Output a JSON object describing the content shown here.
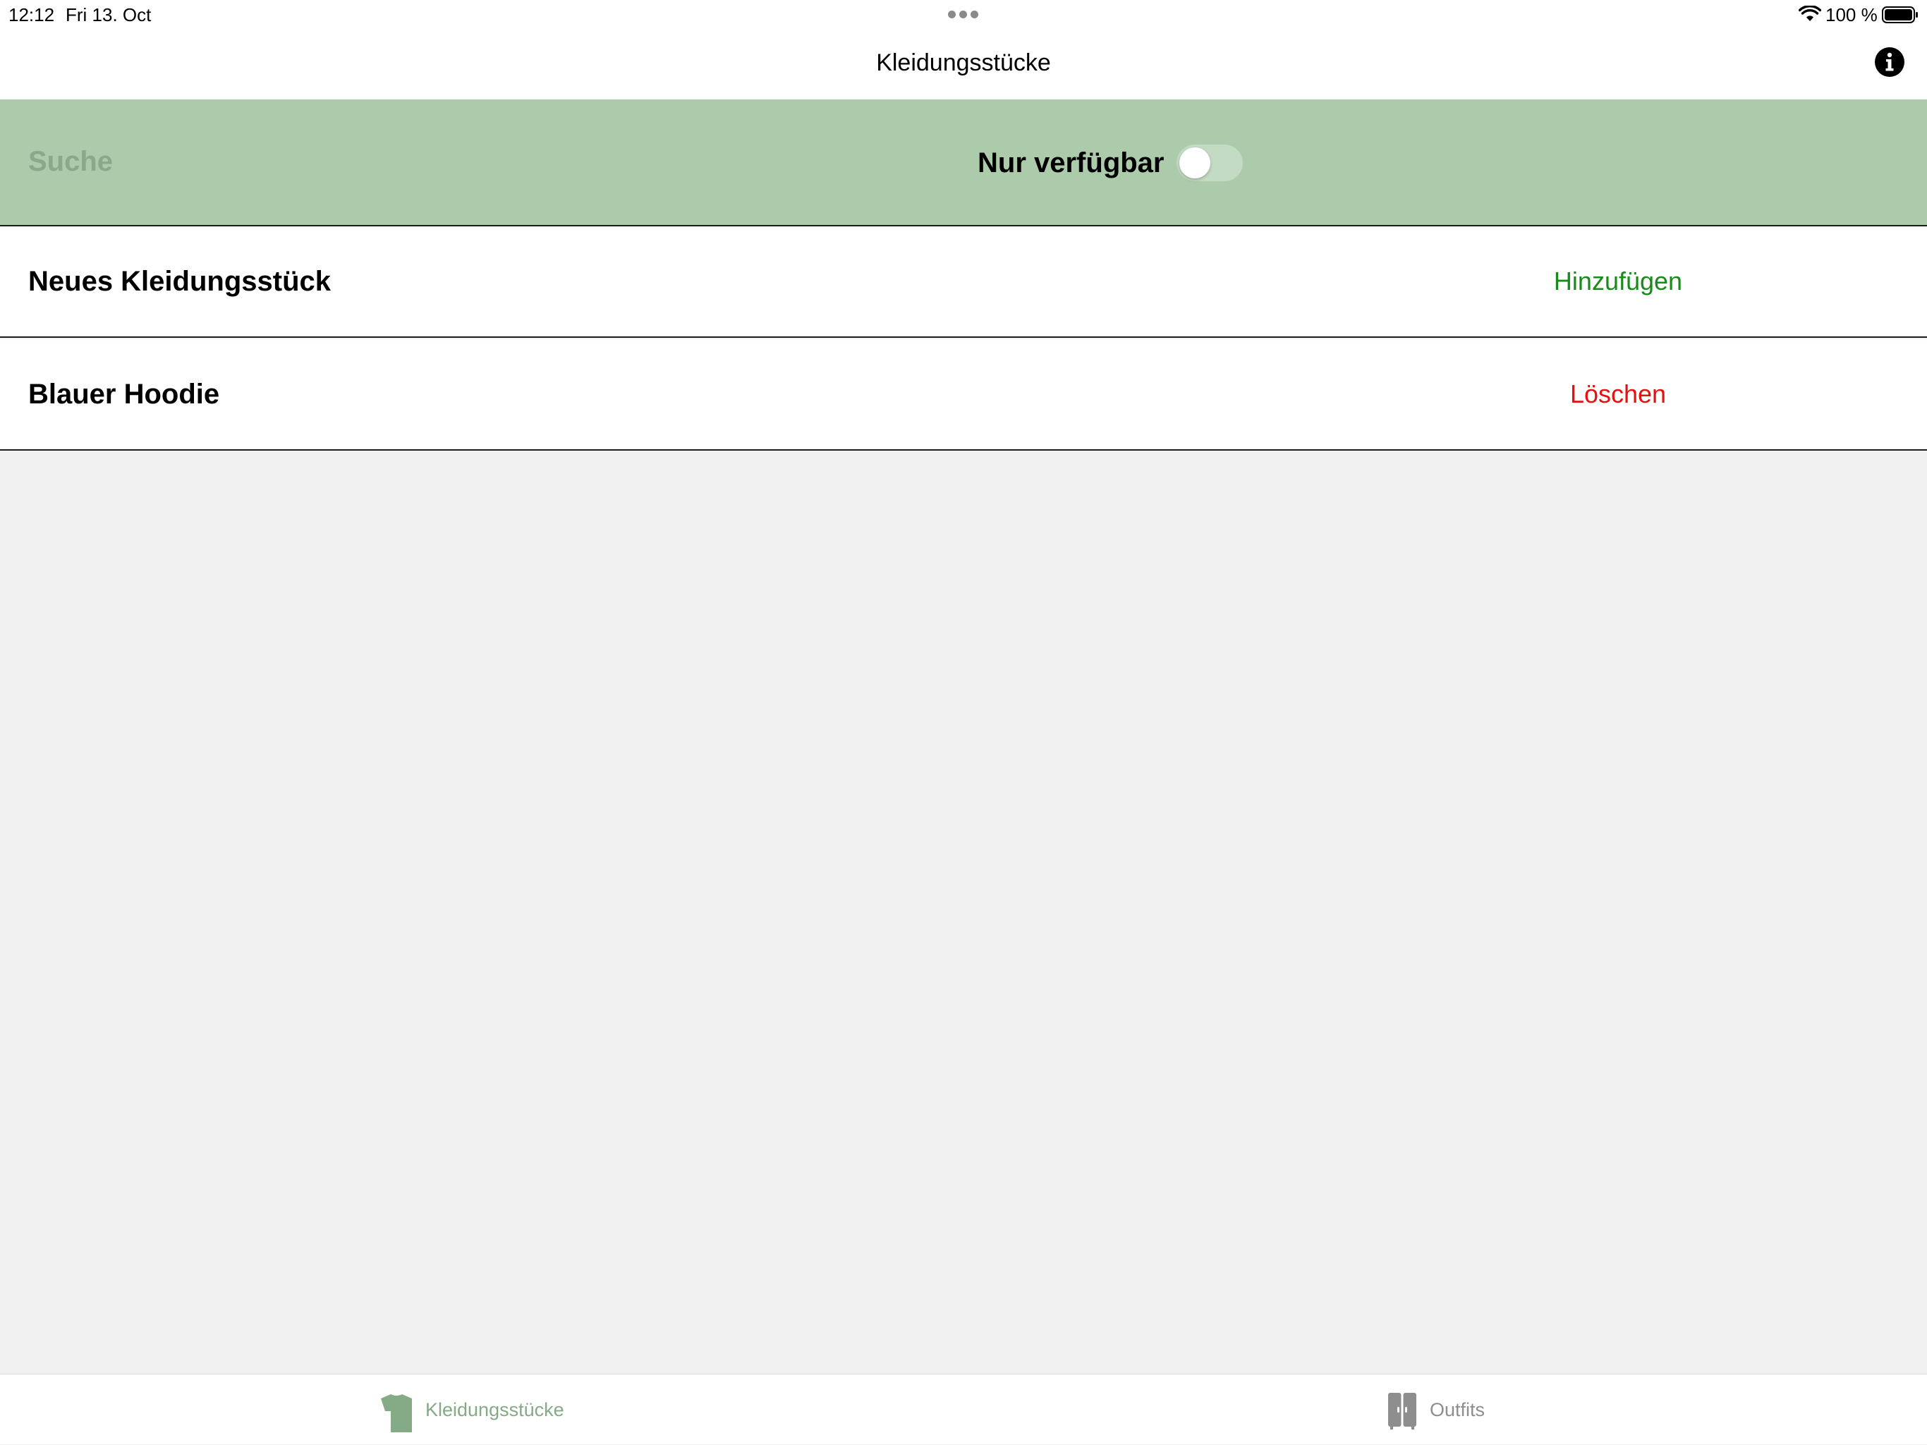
{
  "status_bar": {
    "time": "12:12",
    "date": "Fri 13. Oct",
    "battery_percent": "100 %"
  },
  "nav": {
    "title": "Kleidungsstücke",
    "info_icon": "info-circle-icon"
  },
  "filter": {
    "search_placeholder": "Suche",
    "toggle_label": "Nur verfügbar",
    "toggle_on": false
  },
  "rows": [
    {
      "title": "Neues Kleidungsstück",
      "action": "Hinzufügen",
      "action_color": "#1a8a1a"
    },
    {
      "title": "Blauer Hoodie",
      "action": "Löschen",
      "action_color": "#e3110f"
    }
  ],
  "tabs": [
    {
      "label": "Kleidungsstücke",
      "icon": "tshirt-icon",
      "selected": true
    },
    {
      "label": "Outfits",
      "icon": "wardrobe-icon",
      "selected": false
    }
  ],
  "colors": {
    "filter_background": "#abcbaa",
    "accent": "#84ab85",
    "background": "#f1f1f1"
  }
}
